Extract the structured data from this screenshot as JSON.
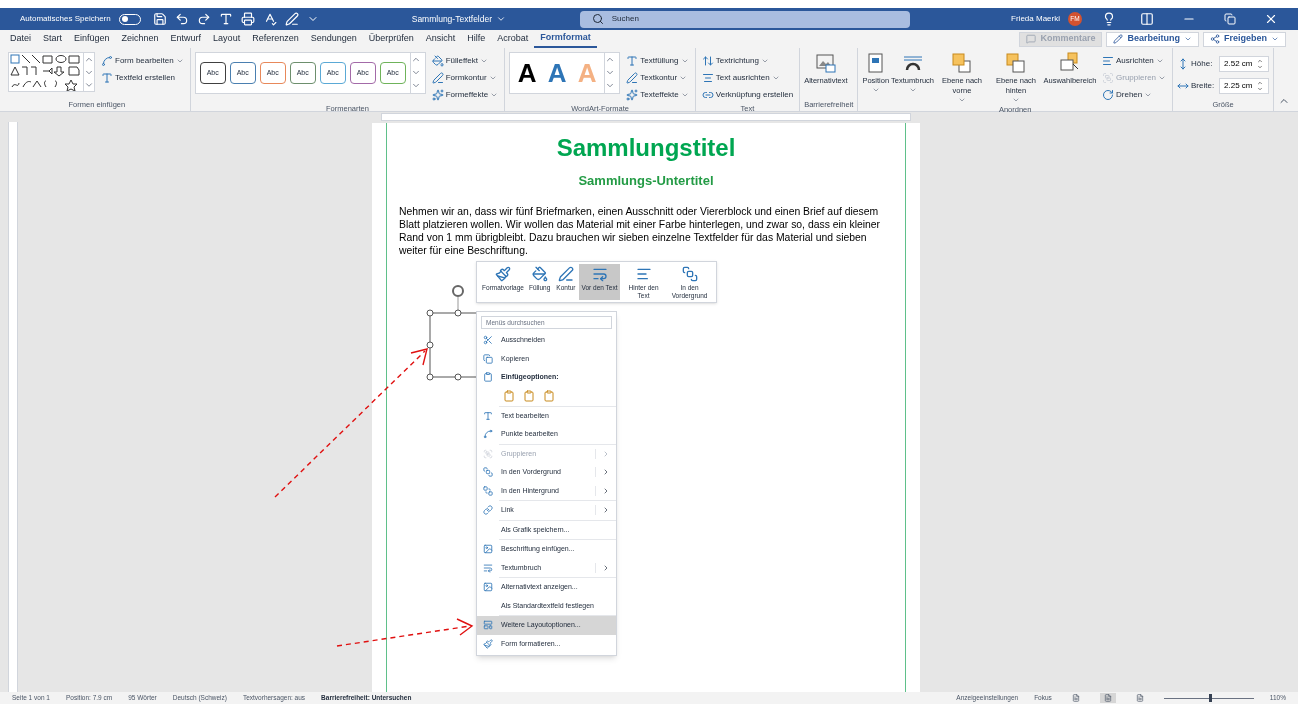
{
  "title_bar": {
    "autosave_label": "Automatisches Speichern",
    "autosave_on": false,
    "document_title": "Sammlung-Textfelder",
    "search_placeholder": "Suchen",
    "user_name": "Frieda Maerki",
    "user_initials": "FM"
  },
  "menu_tabs": [
    {
      "label": "Datei",
      "selected": false
    },
    {
      "label": "Start",
      "selected": false
    },
    {
      "label": "Einfügen",
      "selected": false
    },
    {
      "label": "Zeichnen",
      "selected": false
    },
    {
      "label": "Entwurf",
      "selected": false
    },
    {
      "label": "Layout",
      "selected": false
    },
    {
      "label": "Referenzen",
      "selected": false
    },
    {
      "label": "Sendungen",
      "selected": false
    },
    {
      "label": "Überprüfen",
      "selected": false
    },
    {
      "label": "Ansicht",
      "selected": false
    },
    {
      "label": "Hilfe",
      "selected": false
    },
    {
      "label": "Acrobat",
      "selected": false
    },
    {
      "label": "Formformat",
      "selected": true
    }
  ],
  "top_actions": [
    {
      "label": "Kommentare",
      "disabled": true
    },
    {
      "label": "Bearbeitung",
      "disabled": false
    },
    {
      "label": "Freigeben",
      "disabled": false
    }
  ],
  "ribbon_groups": [
    {
      "label": "Formen einfügen",
      "controls": [
        {
          "kind": "shapes"
        },
        {
          "kind": "small",
          "label": "Form bearbeiten",
          "dropdown": true,
          "disabled": false
        },
        {
          "kind": "small",
          "label": "Textfeld erstellen",
          "dropdown": false,
          "disabled": false
        }
      ]
    },
    {
      "label": "Formenarten",
      "controls": [
        {
          "kind": "style",
          "label": "Abc",
          "color": "#404040"
        },
        {
          "kind": "style",
          "label": "Abc",
          "color": "#4a7fb0"
        },
        {
          "kind": "style",
          "label": "Abc",
          "color": "#e8885a"
        },
        {
          "kind": "style",
          "label": "Abc",
          "color": "#6d8f6d"
        },
        {
          "kind": "style",
          "label": "Abc",
          "color": "#5aa9d6"
        },
        {
          "kind": "style",
          "label": "Abc",
          "color": "#a36aa8"
        },
        {
          "kind": "style",
          "label": "Abc",
          "color": "#6fb35a"
        },
        {
          "kind": "small",
          "label": "Fülleffekt",
          "dropdown": true,
          "disabled": false
        },
        {
          "kind": "small",
          "label": "Formkontur",
          "dropdown": true,
          "disabled": false
        },
        {
          "kind": "small",
          "label": "Formeffekte",
          "dropdown": true,
          "disabled": false
        }
      ]
    },
    {
      "label": "WordArt-Formate",
      "controls": [
        {
          "kind": "wordart",
          "label": "A",
          "color": "#000000"
        },
        {
          "kind": "wordart",
          "label": "A",
          "color": "#2e75b6"
        },
        {
          "kind": "wordart",
          "label": "A",
          "color": "#f4b183"
        },
        {
          "kind": "small",
          "label": "Textfüllung",
          "dropdown": true,
          "disabled": false
        },
        {
          "kind": "small",
          "label": "Textkontur",
          "dropdown": true,
          "disabled": false
        },
        {
          "kind": "small",
          "label": "Texteffekte",
          "dropdown": true,
          "disabled": false
        }
      ]
    },
    {
      "label": "Text",
      "controls": [
        {
          "kind": "small",
          "label": "Textrichtung",
          "dropdown": true,
          "disabled": false
        },
        {
          "kind": "small",
          "label": "Text ausrichten",
          "dropdown": true,
          "disabled": false
        },
        {
          "kind": "small",
          "label": "Verknüpfung erstellen",
          "dropdown": false,
          "disabled": false
        }
      ]
    },
    {
      "label": "Barrierefreiheit",
      "controls": [
        {
          "kind": "large",
          "label": "Alternativtext",
          "dropdown": false
        }
      ]
    },
    {
      "label": "Anordnen",
      "controls": [
        {
          "kind": "large",
          "label": "Position",
          "dropdown": true
        },
        {
          "kind": "large",
          "label": "Textumbruch",
          "dropdown": true
        },
        {
          "kind": "large",
          "label": "Ebene nach vorne",
          "dropdown": true
        },
        {
          "kind": "large",
          "label": "Ebene nach hinten",
          "dropdown": true
        },
        {
          "kind": "large",
          "label": "Auswahlbereich",
          "dropdown": false
        },
        {
          "kind": "small",
          "label": "Ausrichten",
          "dropdown": true,
          "disabled": false
        },
        {
          "kind": "small",
          "label": "Gruppieren",
          "dropdown": true,
          "disabled": true
        },
        {
          "kind": "small",
          "label": "Drehen",
          "dropdown": true,
          "disabled": false
        }
      ]
    },
    {
      "label": "Größe",
      "controls": [
        {
          "kind": "spin",
          "label": "Höhe:",
          "value": "2.52 cm"
        },
        {
          "kind": "spin",
          "label": "Breite:",
          "value": "2.25 cm"
        }
      ]
    }
  ],
  "document": {
    "title": "Sammlungstitel",
    "subtitle": "Sammlungs-Untertitel",
    "paragraph": "Nehmen wir an, dass wir fünf Briefmarken, einen Ausschnitt oder Viererblock und einen Brief auf diesem Blatt platzieren wollen. Wir wollen das Material mit einer Farbe hinterlegen, und zwar so, dass ein kleiner Rand von 1 mm übrigbleibt. Dazu brauchen wir sieben einzelne Textfelder für das Material und sieben weiter für eine Beschriftung."
  },
  "mini_toolbar": [
    {
      "label": "Formatvorlage",
      "selected": false
    },
    {
      "label": "Füllung",
      "selected": false
    },
    {
      "label": "Kontur",
      "selected": false
    },
    {
      "label": "Vor den Text",
      "selected": true
    },
    {
      "label": "Hinter den Text",
      "selected": false
    },
    {
      "label": "In den Vordergrund",
      "selected": false
    }
  ],
  "context_menu": {
    "search_placeholder": "Menüs durchsuchen",
    "sections": [
      [
        {
          "kind": "item",
          "label": "Ausschneiden",
          "disabled": false,
          "submenu": false,
          "selected": false
        },
        {
          "kind": "item",
          "label": "Kopieren",
          "disabled": false,
          "submenu": false,
          "selected": false
        },
        {
          "kind": "header",
          "label": "Einfügeoptionen:"
        },
        {
          "kind": "paste_options"
        }
      ],
      [
        {
          "kind": "item",
          "label": "Text bearbeiten",
          "disabled": false,
          "submenu": false,
          "selected": false
        },
        {
          "kind": "item",
          "label": "Punkte bearbeiten",
          "disabled": false,
          "submenu": false,
          "selected": false
        }
      ],
      [
        {
          "kind": "item",
          "label": "Gruppieren",
          "disabled": true,
          "submenu": true,
          "selected": false
        },
        {
          "kind": "item",
          "label": "In den Vordergrund",
          "disabled": false,
          "submenu": true,
          "selected": false
        },
        {
          "kind": "item",
          "label": "In den Hintergrund",
          "disabled": false,
          "submenu": true,
          "selected": false
        }
      ],
      [
        {
          "kind": "item",
          "label": "Link",
          "disabled": false,
          "submenu": true,
          "selected": false
        }
      ],
      [
        {
          "kind": "item",
          "label": "Als Grafik speichern...",
          "disabled": false,
          "submenu": false,
          "selected": false
        }
      ],
      [
        {
          "kind": "item",
          "label": "Beschriftung einfügen...",
          "disabled": false,
          "submenu": false,
          "selected": false
        },
        {
          "kind": "item",
          "label": "Textumbruch",
          "disabled": false,
          "submenu": true,
          "selected": false
        }
      ],
      [
        {
          "kind": "item",
          "label": "Alternativtext anzeigen...",
          "disabled": false,
          "submenu": false,
          "selected": false
        },
        {
          "kind": "item",
          "label": "Als Standardtextfeld festlegen",
          "disabled": false,
          "submenu": false,
          "selected": false
        }
      ],
      [
        {
          "kind": "item",
          "label": "Weitere Layoutoptionen...",
          "disabled": false,
          "submenu": false,
          "selected": true
        },
        {
          "kind": "item",
          "label": "Form formatieren...",
          "disabled": false,
          "submenu": false,
          "selected": false
        }
      ]
    ]
  },
  "status_bar": {
    "left": [
      "Seite 1 von 1",
      "Position: 7.9 cm",
      "95 Wörter",
      "Deutsch (Schweiz)",
      "Textvorhersagen: aus",
      "Barrierefreiheit: Untersuchen"
    ],
    "display_settings": "Anzeigeeinstellungen",
    "focus": "Fokus",
    "views": [
      {
        "selected": false
      },
      {
        "selected": true
      },
      {
        "selected": false
      }
    ],
    "zoom": {
      "level": 0.5,
      "label": "110%"
    }
  }
}
